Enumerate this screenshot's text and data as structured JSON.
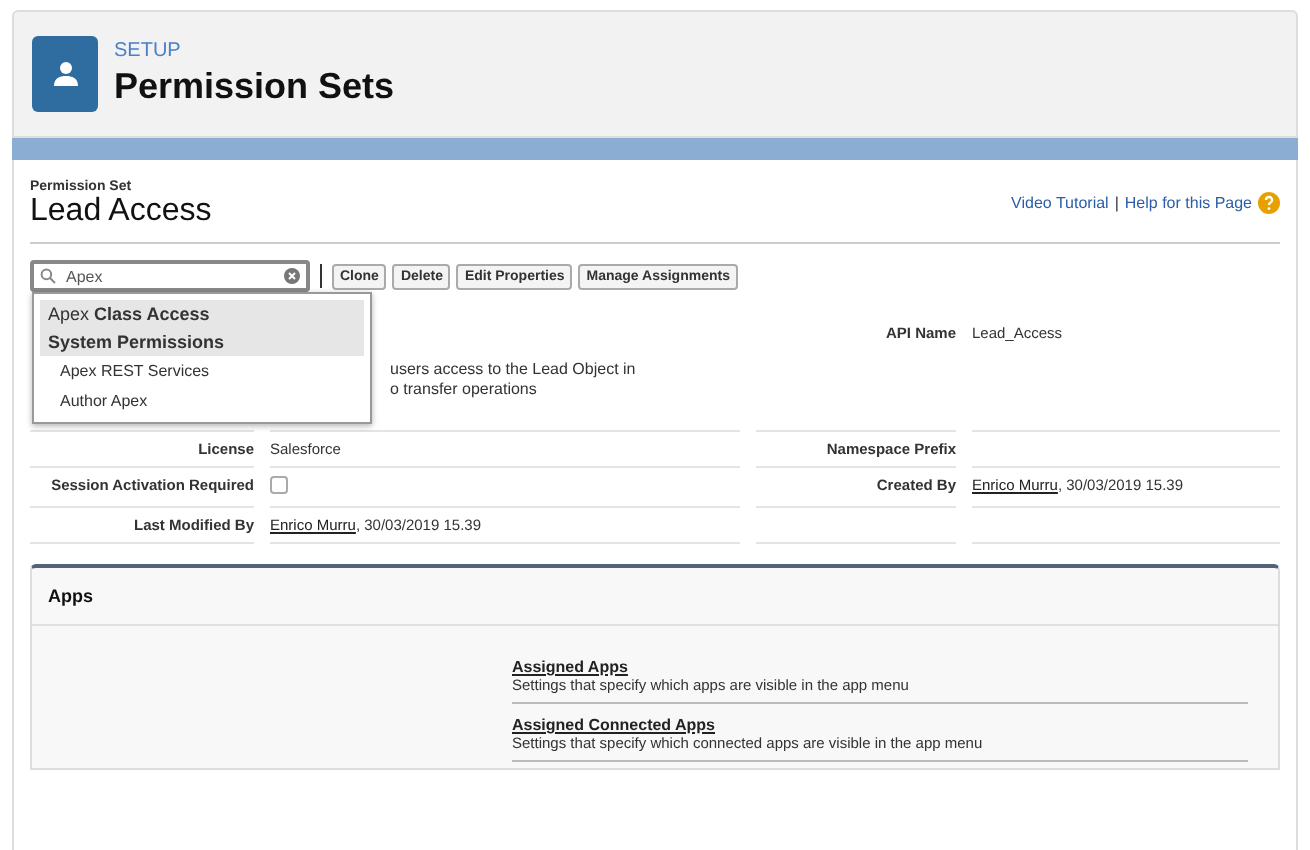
{
  "header": {
    "eyebrow": "SETUP",
    "title": "Permission Sets"
  },
  "record": {
    "type_label": "Permission Set",
    "title": "Lead Access",
    "links": [
      "Video Tutorial",
      "Help for this Page"
    ],
    "separator": "|"
  },
  "search": {
    "value": "Apex"
  },
  "buttons": [
    "Clone",
    "Delete",
    "Edit Properties",
    "Manage Assignments"
  ],
  "dropdown": [
    {
      "kind": "group",
      "prefix": "Apex",
      "label": "Class Access"
    },
    {
      "kind": "group",
      "label": "System Permissions"
    },
    {
      "kind": "item",
      "label": "Apex REST Services"
    },
    {
      "kind": "item",
      "label": "Author Apex"
    }
  ],
  "description": {
    "lines": [
      "users access to the Lead Object in",
      "o transfer operations"
    ]
  },
  "api_name": {
    "label": "API Name",
    "value": "Lead_Access"
  },
  "rows": [
    {
      "label": "License",
      "value": "Salesforce",
      "right_label": "Namespace Prefix"
    },
    {
      "label": "Session Activation Required",
      "kind": "checkbox",
      "checked": false,
      "right_label": "Created By",
      "right_link": "Enrico Murru",
      "right_value": ", 30/03/2019 15.39"
    },
    {
      "label": "Last Modified By",
      "kind": "link",
      "link": "Enrico Murru",
      "value": ", 30/03/2019 15.39"
    }
  ],
  "apps": {
    "title": "Apps",
    "items": [
      {
        "title": "Assigned Apps",
        "desc": "Settings that specify which apps are visible in the app menu"
      },
      {
        "title": "Assigned Connected Apps",
        "desc": "Settings that specify which connected apps are visible in the app menu"
      }
    ]
  }
}
